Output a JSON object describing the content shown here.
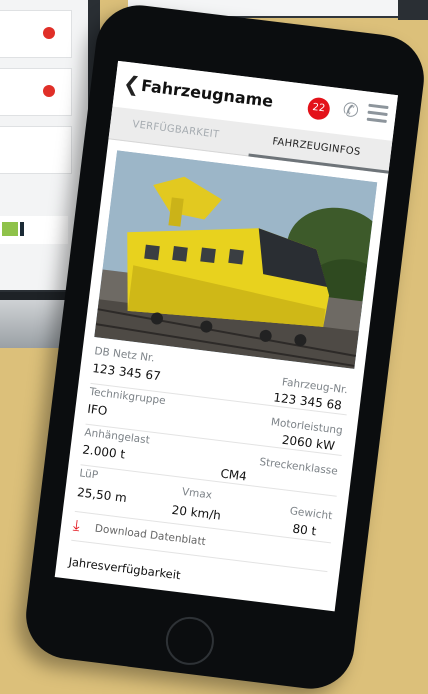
{
  "app": {
    "title": "Fahrzeugname",
    "notification_count": "22"
  },
  "tabs": [
    {
      "label": "VERFÜGBARKEIT",
      "active": false
    },
    {
      "label": "FAHRZEUGINFOS",
      "active": true
    }
  ],
  "details": {
    "db_netz_nr": {
      "label": "DB Netz Nr.",
      "value": "123 345 67"
    },
    "fahrzeug_nr": {
      "label": "Fahrzeug-Nr.",
      "value": "123 345 68"
    },
    "technikgruppe": {
      "label": "Technikgruppe",
      "value": "IFO"
    },
    "motorleistung": {
      "label": "Motorleistung",
      "value": "2060 kW"
    },
    "anhaengelast": {
      "label": "Anhängelast",
      "value": "2.000 t"
    },
    "streckenklasse": {
      "label": "Streckenklasse",
      "value": "CM4"
    },
    "luep": {
      "label": "LüP",
      "value": "25,50 m"
    },
    "vmax": {
      "label": "Vmax",
      "value": "20 km/h"
    },
    "gewicht": {
      "label": "Gewicht",
      "value": "80 t"
    }
  },
  "download": {
    "label": "Download Datenblatt"
  },
  "section": {
    "label": "Jahresverfügbarkeit"
  },
  "colors": {
    "accent": "#e3121a",
    "background": "#dcc07a",
    "vehicle": "#e8d21e"
  },
  "icons": [
    "back-chevron-icon",
    "phone-icon",
    "menu-icon",
    "download-icon"
  ]
}
